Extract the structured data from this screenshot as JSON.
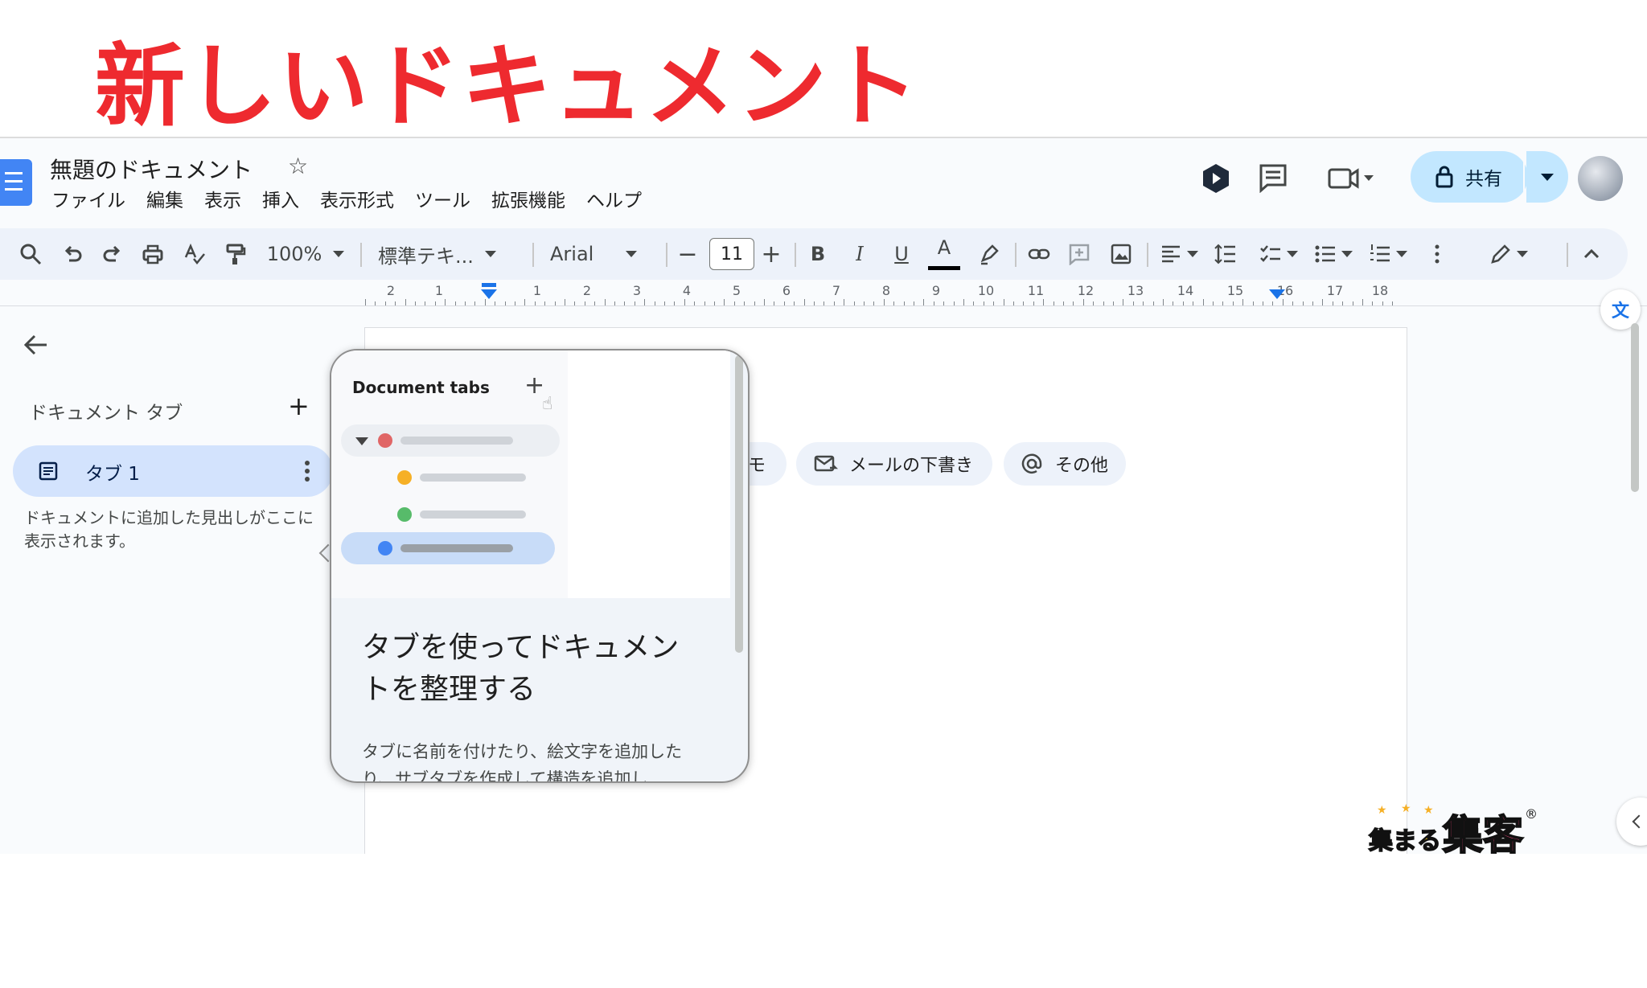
{
  "headline": "新しいドキュメント",
  "doc": {
    "title": "無題のドキュメント",
    "menus": [
      "ファイル",
      "編集",
      "表示",
      "挿入",
      "表示形式",
      "ツール",
      "拡張機能",
      "ヘルプ"
    ],
    "share_label": "共有"
  },
  "toolbar": {
    "zoom": "100%",
    "style": "標準テキ...",
    "font": "Arial",
    "font_size": "11",
    "bold": "B",
    "italic": "I",
    "underline": "U",
    "text_color": "A"
  },
  "ruler": {
    "numbers": [
      "2",
      "1",
      "1",
      "2",
      "3",
      "4",
      "5",
      "6",
      "7",
      "8",
      "9",
      "10",
      "11",
      "12",
      "13",
      "14",
      "15",
      "16",
      "17",
      "18"
    ]
  },
  "sidebar": {
    "header": "ドキュメント タブ",
    "tab_label": "タブ 1",
    "note": "ドキュメントに追加した見出しがここに表示されます。"
  },
  "chips": {
    "memo_partial": "モ",
    "email_draft": "メールの下書き",
    "more": "その他"
  },
  "popup": {
    "illustration_title": "Document tabs",
    "heading": "タブを使ってドキュメントを整理する",
    "body": "タブに名前を付けたり、絵文字を追加したり、サブタブを作成して構造を追加し"
  },
  "watermark": {
    "brand": "集まる集客",
    "mark": "®"
  },
  "colors": {
    "headline": "#ee2a2f",
    "share_bg": "#c2e7ff",
    "tab_selected": "#d3e3fd",
    "accent": "#1a73e8",
    "dot_red": "#e06666",
    "dot_yellow": "#f6b026",
    "dot_green": "#57bb6a",
    "dot_blue": "#4285f4"
  },
  "icons": [
    "docs-logo-icon",
    "star-icon",
    "gemini-icon",
    "comment-icon",
    "meet-icon",
    "lock-icon",
    "search-icon",
    "undo-icon",
    "redo-icon",
    "print-icon",
    "spellcheck-icon",
    "paint-format-icon",
    "highlighter-icon",
    "link-icon",
    "add-comment-icon",
    "image-icon",
    "align-icon",
    "line-spacing-icon",
    "checklist-icon",
    "bullet-list-icon",
    "numbered-list-icon",
    "more-icon",
    "pencil-icon",
    "chevron-up-icon",
    "back-arrow-icon",
    "plus-icon",
    "document-icon",
    "kebab-icon",
    "email-icon",
    "at-icon",
    "translate-icon",
    "chevron-left-icon"
  ]
}
